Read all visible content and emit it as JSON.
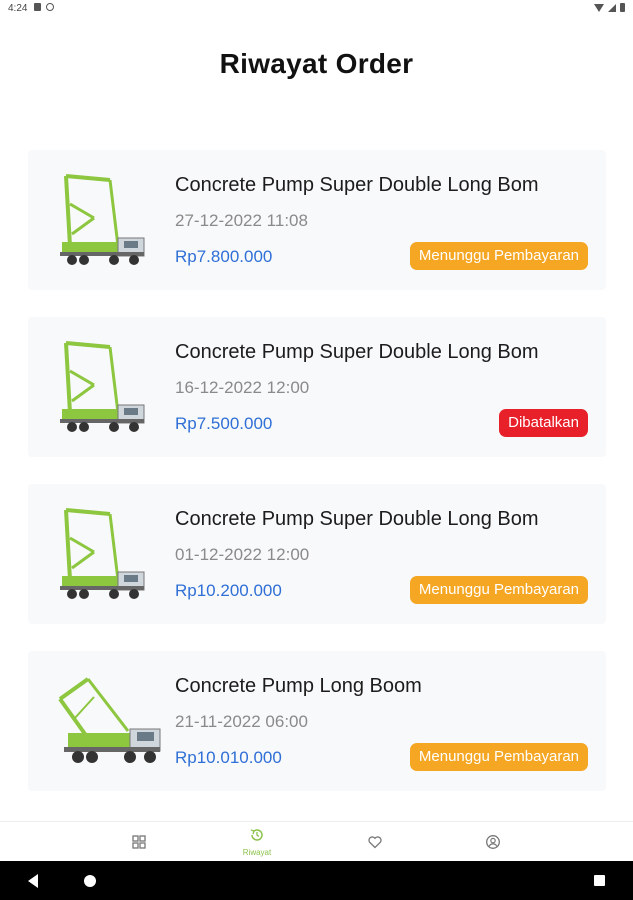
{
  "status_bar": {
    "time": "4:24"
  },
  "header": {
    "title": "Riwayat Order"
  },
  "orders": [
    {
      "product": "Concrete Pump Super Double Long Bom",
      "date": "27-12-2022 11:08",
      "price": "Rp7.800.000",
      "status": "Menunggu Pembayaran",
      "status_color": "#f5a623"
    },
    {
      "product": "Concrete Pump Super Double Long Bom",
      "date": "16-12-2022 12:00",
      "price": "Rp7.500.000",
      "status": "Dibatalkan",
      "status_color": "#e8202a"
    },
    {
      "product": "Concrete Pump Super Double Long Bom",
      "date": "01-12-2022 12:00",
      "price": "Rp10.200.000",
      "status": "Menunggu Pembayaran",
      "status_color": "#f5a623"
    },
    {
      "product": "Concrete Pump Long Boom",
      "date": "21-11-2022 06:00",
      "price": "Rp10.010.000",
      "status": "Menunggu Pembayaran",
      "status_color": "#f5a623"
    }
  ],
  "bottom_nav": {
    "items": [
      {
        "icon": "grid-icon",
        "label": ""
      },
      {
        "icon": "history-icon",
        "label": "Riwayat"
      },
      {
        "icon": "heart-icon",
        "label": ""
      },
      {
        "icon": "profile-icon",
        "label": ""
      }
    ],
    "active_index": 1
  },
  "colors": {
    "accent": "#8bc34a",
    "price": "#2f6fd6"
  }
}
